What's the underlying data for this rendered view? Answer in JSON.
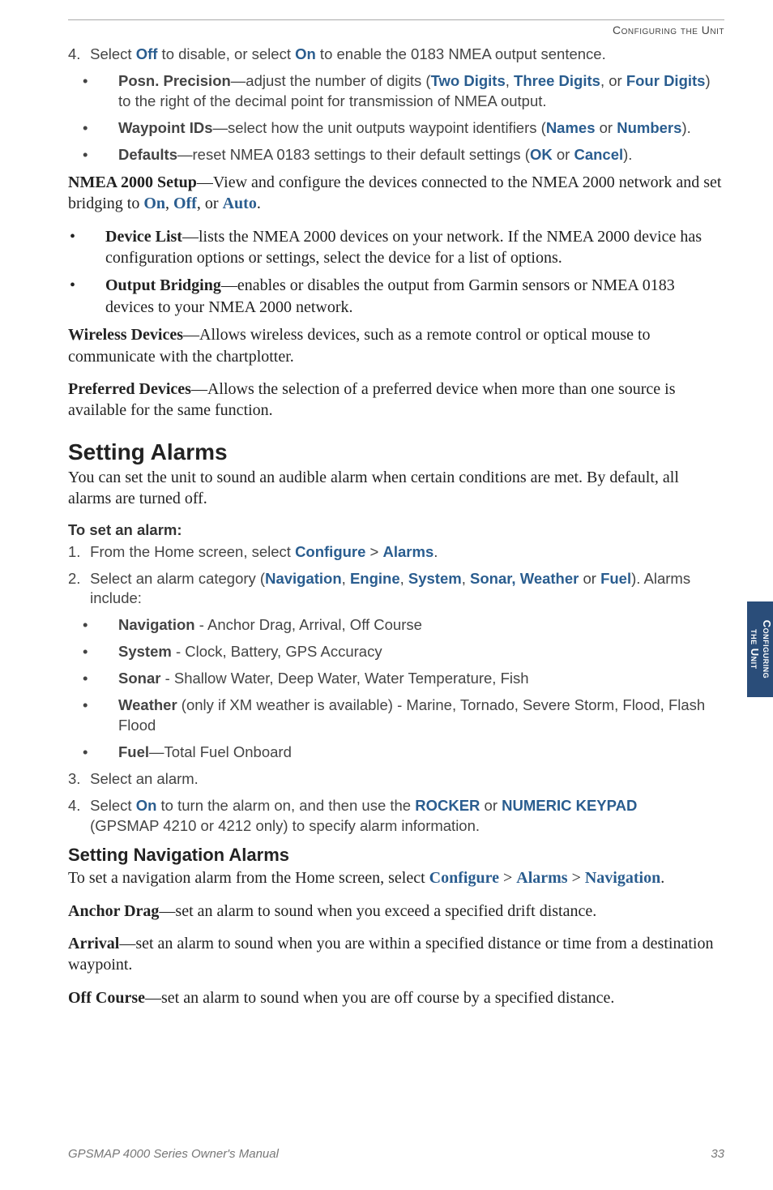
{
  "running_head": "Configuring the Unit",
  "step4": {
    "num": "4.",
    "lead": "Select ",
    "off": "Off",
    "mid1": " to disable, or select ",
    "on": "On",
    "tail": " to enable the 0183 NMEA output sentence."
  },
  "step4_bullets": [
    {
      "b": "Posn. Precision",
      "t1": "—adjust the number of digits (",
      "o1": "Two Digits",
      "sep1": ", ",
      "o2": "Three Digits",
      "sep2": ", or ",
      "o3": "Four Digits",
      "t2": ") to the right of the decimal point for transmission of NMEA output."
    },
    {
      "b": "Waypoint IDs",
      "t1": "—select how the unit outputs waypoint identifiers (",
      "o1": "Names",
      "sep1": " or ",
      "o2": "Numbers",
      "t2": ")."
    },
    {
      "b": "Defaults",
      "t1": "—reset NMEA 0183 settings to their default settings (",
      "o1": "OK",
      "sep1": " or ",
      "o2": "Cancel",
      "t2": ")."
    }
  ],
  "nmea2000": {
    "b": "NMEA 2000 Setup",
    "t1": "—View and configure the devices connected to the NMEA 2000 network and set bridging to ",
    "o1": "On",
    "s1": ", ",
    "o2": "Off",
    "s2": ", or ",
    "o3": "Auto",
    "t2": "."
  },
  "nmea2000_bullets": [
    {
      "b": "Device List",
      "t": "—lists the NMEA 2000 devices on your network. If the NMEA 2000 device has configuration options or settings, select the device for a list of options."
    },
    {
      "b": "Output Bridging",
      "t": "—enables or disables the output from Garmin sensors or NMEA 0183 devices to your NMEA 2000 network."
    }
  ],
  "wireless": {
    "b": "Wireless Devices",
    "t": "—Allows wireless devices, such as a remote control or optical mouse to communicate with the chartplotter."
  },
  "preferred": {
    "b": "Preferred Devices",
    "t": "—Allows the selection of a preferred device when more than one source is available for the same function."
  },
  "setting_alarms": {
    "h": "Setting Alarms",
    "intro": "You can set the unit to sound an audible alarm when certain conditions are met. By default, all alarms are turned off.",
    "proc": "To set an alarm:"
  },
  "alarm_steps": {
    "s1": {
      "num": "1.",
      "t1": "From the Home screen, select ",
      "c": "Configure",
      "gt": " > ",
      "a": "Alarms",
      "t2": "."
    },
    "s2": {
      "num": "2.",
      "t1": "Select an alarm category (",
      "c1": "Navigation",
      "s1": ", ",
      "c2": "Engine",
      "s2": ", ",
      "c3": "System",
      "s3": ", ",
      "c4": "Sonar, Weather",
      "s4": " or ",
      "c5": "Fuel",
      "t2": "). Alarms include:"
    },
    "s2_bullets": [
      {
        "b": "Navigation",
        "t": " - Anchor Drag, Arrival, Off Course"
      },
      {
        "b": "System",
        "t": " - Clock, Battery, GPS Accuracy"
      },
      {
        "b": "Sonar",
        "t": " - Shallow Water, Deep Water, Water Temperature, Fish"
      },
      {
        "b": "Weather",
        "t": " (only if XM weather is available) - Marine, Tornado, Severe Storm, Flood, Flash Flood"
      },
      {
        "b": "Fuel",
        "t": "—Total Fuel Onboard"
      }
    ],
    "s3": {
      "num": "3.",
      "t": "Select an alarm."
    },
    "s4": {
      "num": "4.",
      "t1": "Select ",
      "on": "On",
      "t2": " to turn the alarm on, and then use the ",
      "r": "ROCKER",
      "or": " or ",
      "k": "NUMERIC KEYPAD",
      "t3": " (GPSMAP 4210 or 4212 only) to specify alarm information."
    }
  },
  "nav_alarms": {
    "h": "Setting Navigation Alarms",
    "intro_t1": "To set a navigation alarm from the Home screen, select ",
    "c": "Configure",
    "gt1": " > ",
    "a": "Alarms",
    "gt2": " > ",
    "n": "Navigation",
    "t2": ".",
    "anchor_b": "Anchor Drag",
    "anchor_t": "—set an alarm to sound when you exceed a specified drift distance.",
    "arrival_b": "Arrival",
    "arrival_t": "—set an alarm to sound when you are within a specified distance or time from a destination waypoint.",
    "off_b": "Off Course",
    "off_t": "—set an alarm to sound when you are off course by a specified distance."
  },
  "side_tab_l1": "Configuring",
  "side_tab_l2": "the Unit",
  "footer_left": "GPSMAP 4000 Series Owner's Manual",
  "footer_right": "33"
}
